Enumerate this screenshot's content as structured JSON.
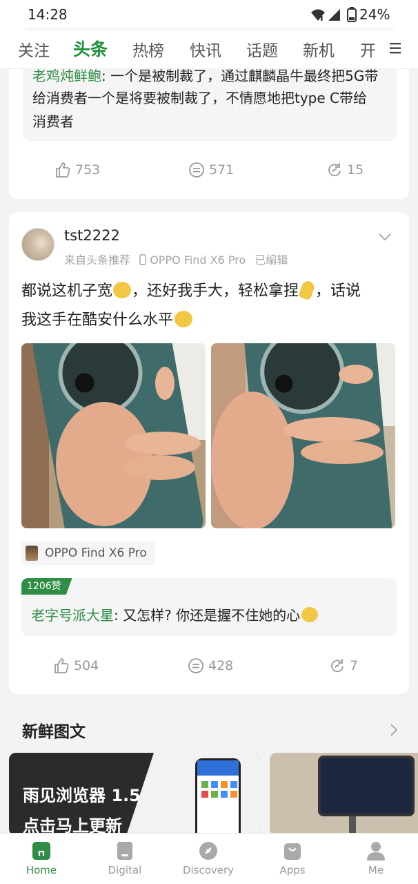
{
  "status_bar": {
    "time": "14:28",
    "battery": "24%"
  },
  "tabs": [
    "关注",
    "头条",
    "热榜",
    "快讯",
    "话题",
    "新机",
    "开"
  ],
  "active_tab": 1,
  "top_card": {
    "comment_user_partial": "老鸡炖鲜鲍",
    "comment_text_partial": ": 一个是被制裁了，通过麒麟晶牛最终把5G带",
    "comment_line2": "给消费者一个是将要被制裁了，不情愿地把type C带给",
    "comment_line3": "消费者",
    "likes": "753",
    "comments": "571",
    "shares": "15"
  },
  "post": {
    "username": "tst2222",
    "source": "来自头条推荐",
    "device": "OPPO Find X6 Pro",
    "edited": "已编辑",
    "text_line1": "都说这机子宽",
    "text_line1b": "，还好我手大，轻松拿捏",
    "text_line1c": "，话说",
    "text_line2": "我这手在酷安什么水平",
    "topic_tag": "OPPO Find X6 Pro",
    "hot_badge": "1206赞",
    "hot_comment_user": "老字号派大星",
    "hot_comment_text": ": 又怎样? 你还是握不住她的心",
    "likes": "504",
    "comments": "428",
    "shares": "7"
  },
  "section": {
    "title": "新鲜图文",
    "banner_line1": "雨见浏览器 1.5",
    "banner_line2": "点击马上更新"
  },
  "bottom_nav": [
    {
      "label": "Home",
      "icon": "home-icon"
    },
    {
      "label": "Digital",
      "icon": "digital-icon"
    },
    {
      "label": "Discovery",
      "icon": "compass-icon"
    },
    {
      "label": "Apps",
      "icon": "apps-bag-icon"
    },
    {
      "label": "Me",
      "icon": "person-icon"
    }
  ],
  "colors": {
    "accent": "#2f8d45",
    "phone_body": "#3f6b6a"
  }
}
